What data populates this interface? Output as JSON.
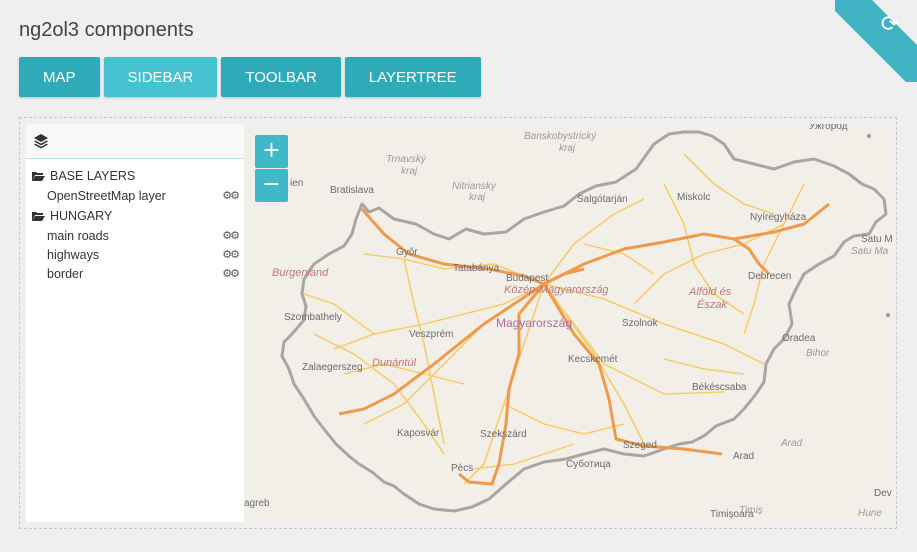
{
  "app": {
    "title": "ng2ol3 components"
  },
  "nav": {
    "buttons": [
      {
        "label": "MAP",
        "active": false
      },
      {
        "label": "SIDEBAR",
        "active": true
      },
      {
        "label": "TOOLBAR",
        "active": false
      },
      {
        "label": "LAYERTREE",
        "active": false
      }
    ]
  },
  "ribbon": {
    "icon": "refresh-icon"
  },
  "sidebar": {
    "header_icon": "layers-icon",
    "groups": [
      {
        "label": "BASE LAYERS",
        "layers": [
          {
            "label": "OpenStreetMap layer"
          }
        ]
      },
      {
        "label": "HUNGARY",
        "layers": [
          {
            "label": "main roads"
          },
          {
            "label": "highways"
          },
          {
            "label": "border"
          }
        ]
      }
    ]
  },
  "map": {
    "zoom_in_label": "+",
    "zoom_out_label": "−",
    "labels": {
      "bratislava": "Bratislava",
      "banskobystricky": "Banskobystrický",
      "kraj1": "kraj",
      "trnavsky": "Trnavský",
      "kraj2": "kraj",
      "nitriansky": "Nitriansky",
      "kraj3": "kraj",
      "uzhgorod": "Ужгород",
      "wien": "ien",
      "salgotarjan": "Salgótarján",
      "miskolc": "Miskolc",
      "nyiregyhaza": "Nyíregyháza",
      "satu_mare": "Satu M",
      "satu_mare2": "Satu Ma",
      "gyor": "Győr",
      "tatabanya": "Tatabánya",
      "budapest": "Budapest",
      "kozep": "Közép-Magyarország",
      "debrecen": "Debrecen",
      "burgenland": "Burgenland",
      "szombathely": "Szombathely",
      "veszprem": "Veszprém",
      "magyarorszag": "Magyarország",
      "szolnok": "Szolnok",
      "alfold": "Alföld és",
      "eszak": "Észak",
      "oradea": "Oradea",
      "bihor": "Bihor",
      "dunantul": "Dunántúl",
      "zalaegerszeg": "Zalaegerszeg",
      "kecskemet": "Kecskemét",
      "bekescsaba": "Békéscsaba",
      "kaposvar": "Kaposvár",
      "szekszard": "Szekszárd",
      "arad_region": "Arad",
      "szeged": "Szeged",
      "arad": "Arad",
      "pecs": "Pécs",
      "subotica": "Суботица",
      "zagreb": "agreb",
      "timisoara": "Timișoara",
      "timis": "Timiș",
      "hune": "Hune",
      "dev": "Dev"
    }
  }
}
